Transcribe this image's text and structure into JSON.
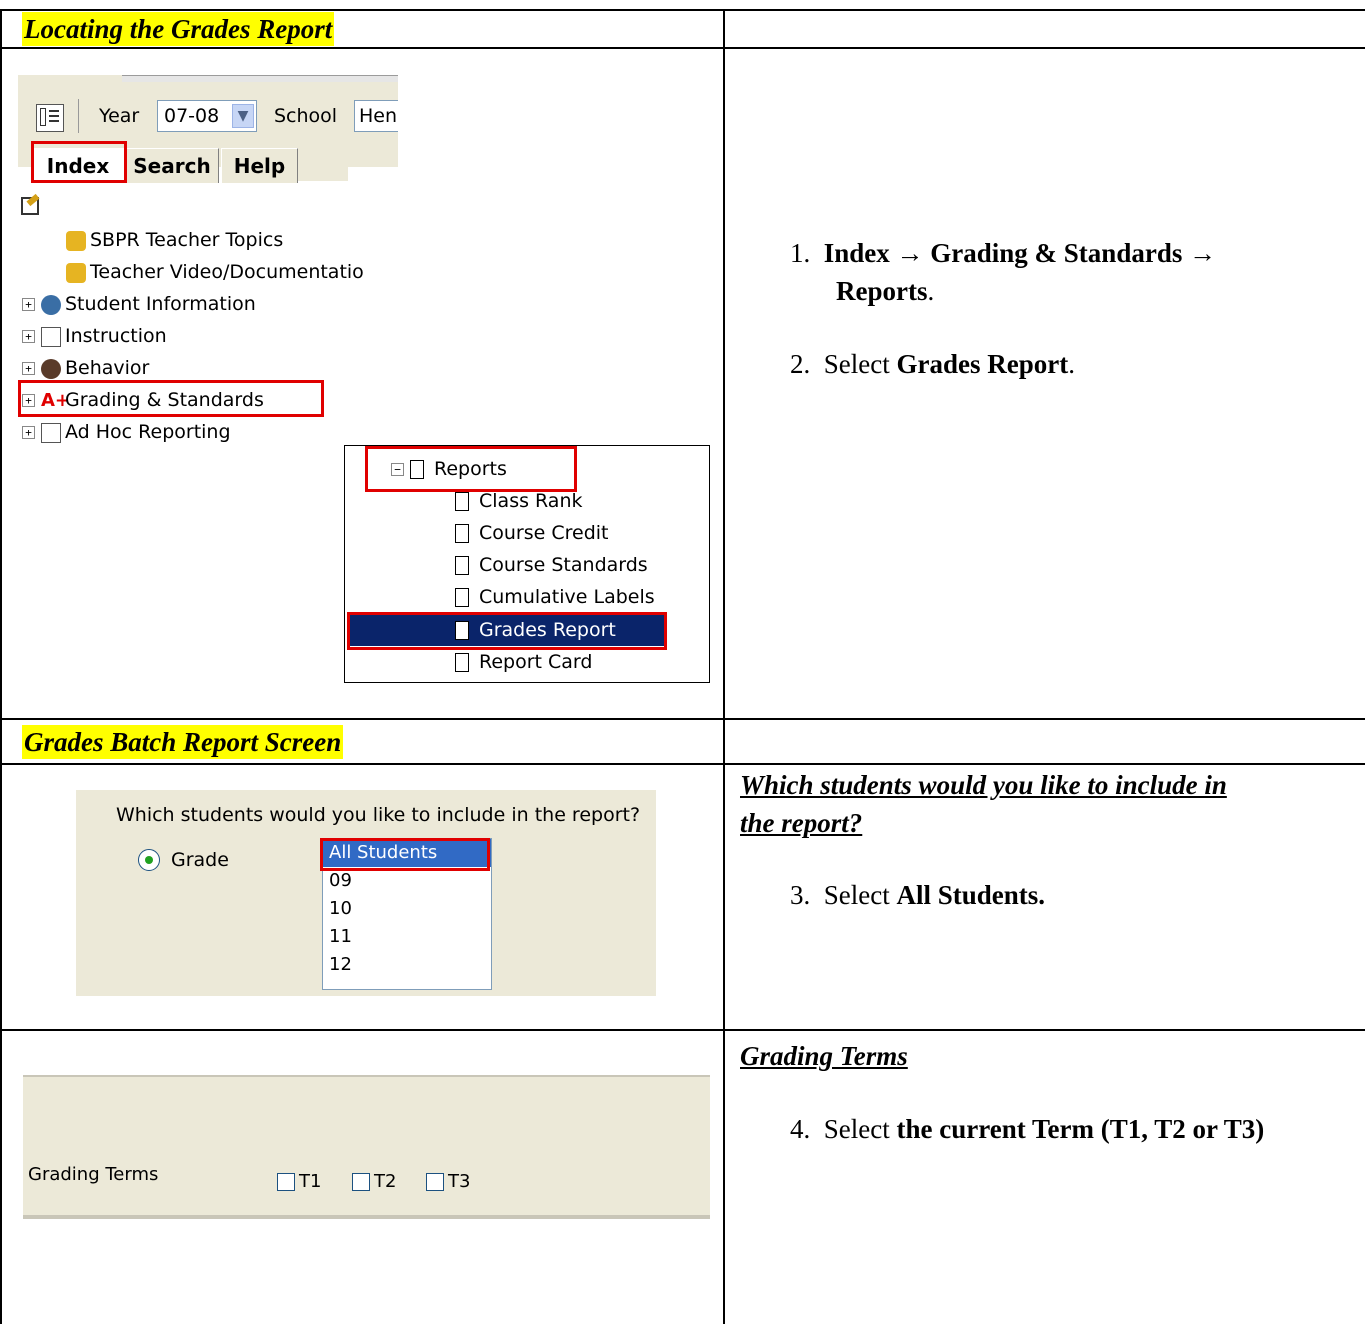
{
  "sections": {
    "locating_title": "Locating the Grades Report",
    "batch_title": "Grades Batch Report Screen"
  },
  "toolbar": {
    "year_label": "Year",
    "year_value": "07-08",
    "school_label": "School",
    "school_value": "Hen"
  },
  "tabs": [
    "Index",
    "Search",
    "Help"
  ],
  "tree": {
    "items": [
      "SBPR Teacher Topics",
      "Teacher Video/Documentatio",
      "Student Information",
      "Instruction",
      "Behavior",
      "Grading & Standards",
      "Ad Hoc Reporting"
    ]
  },
  "reports": {
    "folder": "Reports",
    "items": [
      "Class Rank",
      "Course Credit",
      "Course Standards",
      "Cumulative Labels",
      "Grades Report",
      "Report Card"
    ],
    "selected": "Grades Report"
  },
  "instructions": {
    "step1_num": "1.",
    "step1_a": "Index",
    "step1_b": "Grading & Standards",
    "step1_c": "Reports",
    "step2_num": "2.",
    "step2_pre": "Select ",
    "step2_bold": "Grades Report",
    "students_heading_1": "Which students would you like to include in",
    "students_heading_2": "the report?",
    "step3_num": "3.",
    "step3_pre": "Select ",
    "step3_bold": "All Students.",
    "terms_heading": "Grading Terms",
    "step4_num": "4.",
    "step4_pre": "Select ",
    "step4_bold": "the current Term (T1, T2 or T3)"
  },
  "students_form": {
    "question": "Which students would you like to include in the report?",
    "radio_label": "Grade",
    "options": [
      "All Students",
      "09",
      "10",
      "11",
      "12"
    ],
    "selected": "All Students"
  },
  "terms_form": {
    "label": "Grading Terms",
    "terms": [
      "T1",
      "T2",
      "T3"
    ]
  },
  "colors": {
    "highlight": "#ffff00",
    "callout": "#e00000",
    "selection": "#0a246a"
  }
}
